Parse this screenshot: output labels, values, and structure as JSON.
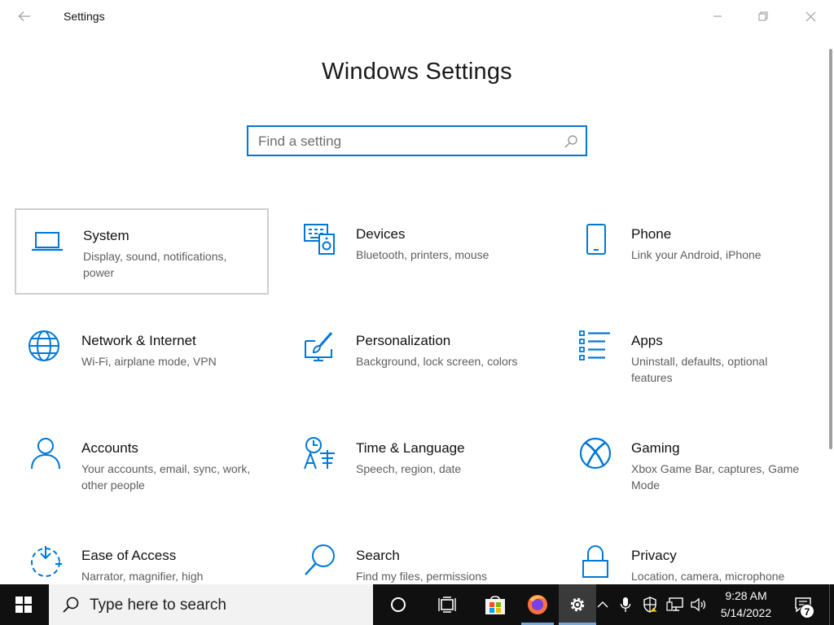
{
  "window": {
    "title": "Settings",
    "back_icon": "back-arrow-icon",
    "controls": [
      "minimize-icon",
      "maximize-icon",
      "close-icon"
    ]
  },
  "heading": "Windows Settings",
  "search": {
    "placeholder": "Find a setting",
    "value": "",
    "icon": "search-icon"
  },
  "accent_color": "#0078d7",
  "tiles": [
    {
      "title": "System",
      "desc": "Display, sound, notifications, power",
      "icon": "laptop-icon",
      "selected": true
    },
    {
      "title": "Devices",
      "desc": "Bluetooth, printers, mouse",
      "icon": "devices-icon",
      "selected": false
    },
    {
      "title": "Phone",
      "desc": "Link your Android, iPhone",
      "icon": "phone-icon",
      "selected": false
    },
    {
      "title": "Network & Internet",
      "desc": "Wi-Fi, airplane mode, VPN",
      "icon": "globe-icon",
      "selected": false
    },
    {
      "title": "Personalization",
      "desc": "Background, lock screen, colors",
      "icon": "paintbrush-icon",
      "selected": false
    },
    {
      "title": "Apps",
      "desc": "Uninstall, defaults, optional features",
      "icon": "apps-list-icon",
      "selected": false
    },
    {
      "title": "Accounts",
      "desc": "Your accounts, email, sync, work, other people",
      "icon": "person-icon",
      "selected": false
    },
    {
      "title": "Time & Language",
      "desc": "Speech, region, date",
      "icon": "time-language-icon",
      "selected": false
    },
    {
      "title": "Gaming",
      "desc": "Xbox Game Bar, captures, Game Mode",
      "icon": "xbox-icon",
      "selected": false
    },
    {
      "title": "Ease of Access",
      "desc": "Narrator, magnifier, high",
      "icon": "ease-of-access-icon",
      "selected": false
    },
    {
      "title": "Search",
      "desc": "Find my files, permissions",
      "icon": "magnifier-icon",
      "selected": false
    },
    {
      "title": "Privacy",
      "desc": "Location, camera, microphone",
      "icon": "lock-icon",
      "selected": false
    }
  ],
  "taskbar": {
    "search_text": "Type here to search",
    "pinned": [
      "windows-start-icon",
      "cortana-icon",
      "task-view-icon",
      "store-icon",
      "firefox-icon",
      "settings-gear-icon"
    ],
    "tray": [
      "chevron-up-icon",
      "microphone-icon",
      "security-shield-icon",
      "network-icon",
      "volume-icon"
    ],
    "time": "9:28 AM",
    "date": "5/14/2022",
    "notification_count": "7"
  }
}
